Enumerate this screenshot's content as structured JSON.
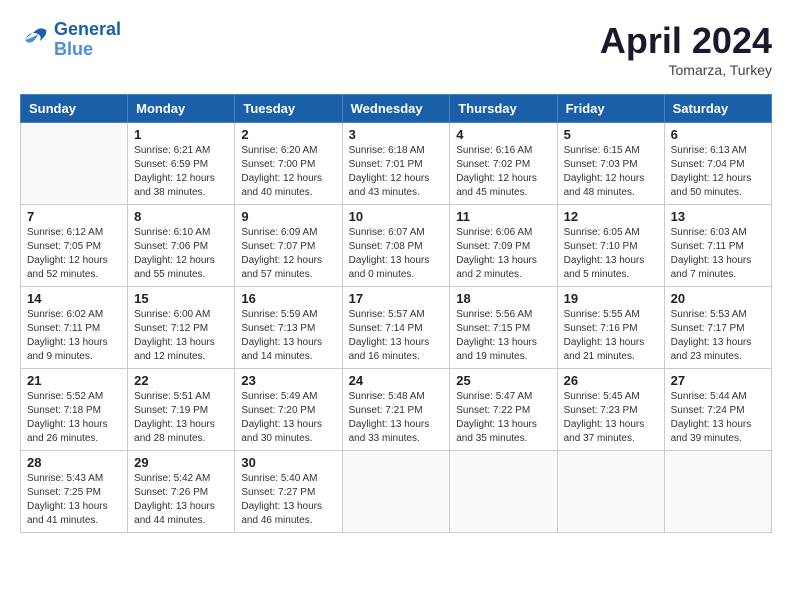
{
  "header": {
    "logo_line1": "General",
    "logo_line2": "Blue",
    "title": "April 2024",
    "location": "Tomarza, Turkey"
  },
  "columns": [
    "Sunday",
    "Monday",
    "Tuesday",
    "Wednesday",
    "Thursday",
    "Friday",
    "Saturday"
  ],
  "weeks": [
    [
      {
        "day": "",
        "info": ""
      },
      {
        "day": "1",
        "info": "Sunrise: 6:21 AM\nSunset: 6:59 PM\nDaylight: 12 hours\nand 38 minutes."
      },
      {
        "day": "2",
        "info": "Sunrise: 6:20 AM\nSunset: 7:00 PM\nDaylight: 12 hours\nand 40 minutes."
      },
      {
        "day": "3",
        "info": "Sunrise: 6:18 AM\nSunset: 7:01 PM\nDaylight: 12 hours\nand 43 minutes."
      },
      {
        "day": "4",
        "info": "Sunrise: 6:16 AM\nSunset: 7:02 PM\nDaylight: 12 hours\nand 45 minutes."
      },
      {
        "day": "5",
        "info": "Sunrise: 6:15 AM\nSunset: 7:03 PM\nDaylight: 12 hours\nand 48 minutes."
      },
      {
        "day": "6",
        "info": "Sunrise: 6:13 AM\nSunset: 7:04 PM\nDaylight: 12 hours\nand 50 minutes."
      }
    ],
    [
      {
        "day": "7",
        "info": "Sunrise: 6:12 AM\nSunset: 7:05 PM\nDaylight: 12 hours\nand 52 minutes."
      },
      {
        "day": "8",
        "info": "Sunrise: 6:10 AM\nSunset: 7:06 PM\nDaylight: 12 hours\nand 55 minutes."
      },
      {
        "day": "9",
        "info": "Sunrise: 6:09 AM\nSunset: 7:07 PM\nDaylight: 12 hours\nand 57 minutes."
      },
      {
        "day": "10",
        "info": "Sunrise: 6:07 AM\nSunset: 7:08 PM\nDaylight: 13 hours\nand 0 minutes."
      },
      {
        "day": "11",
        "info": "Sunrise: 6:06 AM\nSunset: 7:09 PM\nDaylight: 13 hours\nand 2 minutes."
      },
      {
        "day": "12",
        "info": "Sunrise: 6:05 AM\nSunset: 7:10 PM\nDaylight: 13 hours\nand 5 minutes."
      },
      {
        "day": "13",
        "info": "Sunrise: 6:03 AM\nSunset: 7:11 PM\nDaylight: 13 hours\nand 7 minutes."
      }
    ],
    [
      {
        "day": "14",
        "info": "Sunrise: 6:02 AM\nSunset: 7:11 PM\nDaylight: 13 hours\nand 9 minutes."
      },
      {
        "day": "15",
        "info": "Sunrise: 6:00 AM\nSunset: 7:12 PM\nDaylight: 13 hours\nand 12 minutes."
      },
      {
        "day": "16",
        "info": "Sunrise: 5:59 AM\nSunset: 7:13 PM\nDaylight: 13 hours\nand 14 minutes."
      },
      {
        "day": "17",
        "info": "Sunrise: 5:57 AM\nSunset: 7:14 PM\nDaylight: 13 hours\nand 16 minutes."
      },
      {
        "day": "18",
        "info": "Sunrise: 5:56 AM\nSunset: 7:15 PM\nDaylight: 13 hours\nand 19 minutes."
      },
      {
        "day": "19",
        "info": "Sunrise: 5:55 AM\nSunset: 7:16 PM\nDaylight: 13 hours\nand 21 minutes."
      },
      {
        "day": "20",
        "info": "Sunrise: 5:53 AM\nSunset: 7:17 PM\nDaylight: 13 hours\nand 23 minutes."
      }
    ],
    [
      {
        "day": "21",
        "info": "Sunrise: 5:52 AM\nSunset: 7:18 PM\nDaylight: 13 hours\nand 26 minutes."
      },
      {
        "day": "22",
        "info": "Sunrise: 5:51 AM\nSunset: 7:19 PM\nDaylight: 13 hours\nand 28 minutes."
      },
      {
        "day": "23",
        "info": "Sunrise: 5:49 AM\nSunset: 7:20 PM\nDaylight: 13 hours\nand 30 minutes."
      },
      {
        "day": "24",
        "info": "Sunrise: 5:48 AM\nSunset: 7:21 PM\nDaylight: 13 hours\nand 33 minutes."
      },
      {
        "day": "25",
        "info": "Sunrise: 5:47 AM\nSunset: 7:22 PM\nDaylight: 13 hours\nand 35 minutes."
      },
      {
        "day": "26",
        "info": "Sunrise: 5:45 AM\nSunset: 7:23 PM\nDaylight: 13 hours\nand 37 minutes."
      },
      {
        "day": "27",
        "info": "Sunrise: 5:44 AM\nSunset: 7:24 PM\nDaylight: 13 hours\nand 39 minutes."
      }
    ],
    [
      {
        "day": "28",
        "info": "Sunrise: 5:43 AM\nSunset: 7:25 PM\nDaylight: 13 hours\nand 41 minutes."
      },
      {
        "day": "29",
        "info": "Sunrise: 5:42 AM\nSunset: 7:26 PM\nDaylight: 13 hours\nand 44 minutes."
      },
      {
        "day": "30",
        "info": "Sunrise: 5:40 AM\nSunset: 7:27 PM\nDaylight: 13 hours\nand 46 minutes."
      },
      {
        "day": "",
        "info": ""
      },
      {
        "day": "",
        "info": ""
      },
      {
        "day": "",
        "info": ""
      },
      {
        "day": "",
        "info": ""
      }
    ]
  ]
}
